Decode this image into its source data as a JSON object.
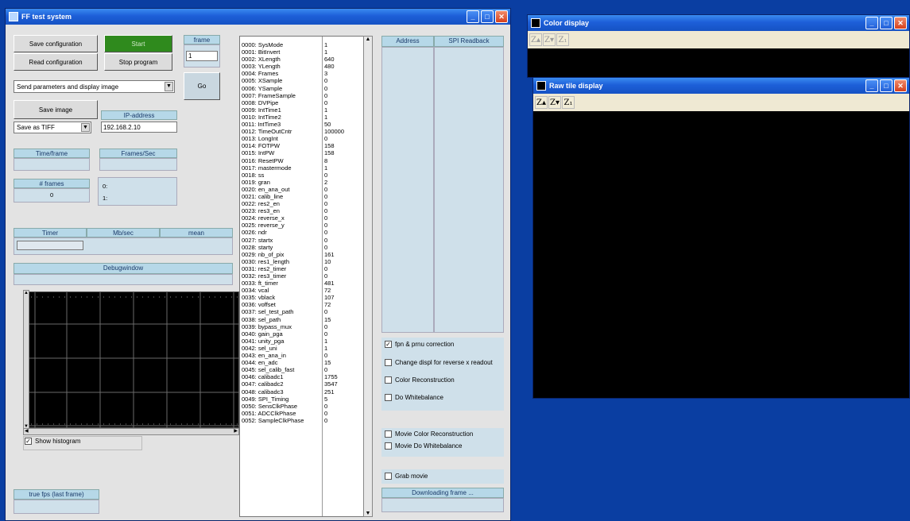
{
  "main_window": {
    "title": "FF test system",
    "buttons": {
      "save_config": "Save configuration",
      "read_config": "Read configuration",
      "start": "Start",
      "stop": "Stop program",
      "go": "Go",
      "save_image": "Save image"
    },
    "frame_label": "frame",
    "frame_value": "1",
    "send_mode": "Send parameters and display image",
    "ip_label": "IP-address",
    "ip_value": "192.168.2.10",
    "save_format": "Save as TIFF",
    "time_frame_label": "Time/frame",
    "frames_sec_label": "Frames/Sec",
    "nframes_label": "# frames",
    "nframes_value": "0",
    "channel0": "0:",
    "channel1": "1:",
    "timer_label": "Timer",
    "mbsec_label": "Mb/sec",
    "mean_label": "mean",
    "debug_label": "Debugwindow",
    "show_histogram": "Show histogram",
    "true_fps_label": "true fps (last frame)",
    "registers": [
      "0000: SysMode",
      "0001: BitInvert",
      "0002: XLength",
      "0003: YLength",
      "0004: Frames",
      "0005: XSample",
      "0006: YSample",
      "0007: FrameSample",
      "0008: DVPipe",
      "0009: IntTime1",
      "0010: IntTime2",
      "0011: IntTime3",
      "0012: TimeOutCntr",
      "0013: LongInt",
      "0014: FOTPW",
      "0015: IntPW",
      "0016: ResetPW",
      "0017: mastermode",
      "0018: ss",
      "0019: gran",
      "0020: en_ana_out",
      "0021: calib_line",
      "0022: res2_en",
      "0023: res3_en",
      "0024: reverse_x",
      "0025: reverse_y",
      "0026: ndr",
      "0027: startx",
      "0028: starty",
      "0029: nb_of_pix",
      "0030: res1_length",
      "0031: res2_timer",
      "0032: res3_timer",
      "0033: ft_timer",
      "0034: vcal",
      "0035: vblack",
      "0036: voffset",
      "0037: sel_test_path",
      "0038: sel_path",
      "0039: bypass_mux",
      "0040: gain_pga",
      "0041: unity_pga",
      "0042: sel_uni",
      "0043: en_ana_in",
      "0044: en_adc",
      "0045: sel_calib_fast",
      "0046: calibadc1",
      "0047: calibadc2",
      "0048: calibadc3",
      "0049: SPI_Timing",
      "0050: SensClkPhase",
      "0051: ADCClkPhase",
      "0052: SampleClkPhase"
    ],
    "values": [
      "1",
      "1",
      "640",
      "480",
      "3",
      "0",
      "0",
      "0",
      "0",
      "1",
      "1",
      "50",
      "100000",
      "0",
      "158",
      "158",
      "8",
      "1",
      "0",
      "2",
      "0",
      "0",
      "0",
      "0",
      "0",
      "0",
      "0",
      "0",
      "0",
      "161",
      "10",
      "0",
      "0",
      "481",
      "72",
      "107",
      "72",
      "0",
      "15",
      "0",
      "0",
      "1",
      "1",
      "0",
      "15",
      "0",
      "1755",
      "3547",
      "251",
      "5",
      "0",
      "0",
      "0"
    ],
    "address_label": "Address",
    "spi_label": "SPI Readback",
    "options": {
      "fpn": "fpn & prnu correction",
      "change_displ": "Change displ for reverse x readout",
      "color_recon": "Color Reconstruction",
      "whitebalance": "Do Whitebalance",
      "movie_color": "Movie Color Reconstruction",
      "movie_white": "Movie Do Whitebalance",
      "grab_movie": "Grab movie"
    },
    "downloading": "Downloading frame ..."
  },
  "color_window": {
    "title": "Color display"
  },
  "raw_window": {
    "title": "Raw tile display"
  }
}
